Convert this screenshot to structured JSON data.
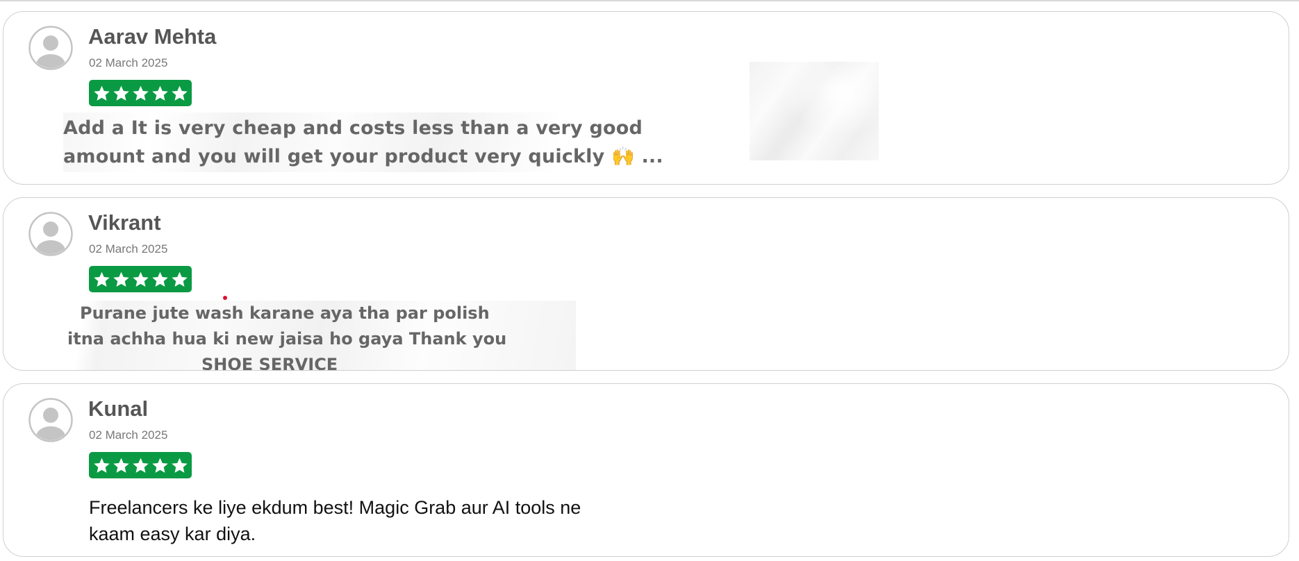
{
  "reviews": [
    {
      "name": "Aarav Mehta",
      "date": "02 March 2025",
      "rating": 5,
      "text_lines": [
        "Add a It is very cheap and costs less than a very good",
        "amount and you will get your product very quickly 🙌 ..."
      ],
      "text_style": "image"
    },
    {
      "name": "Vikrant",
      "date": "02 March 2025",
      "rating": 5,
      "text_lines": [
        "Purane jute wash karane aya tha par polish",
        "itna achha hua ki new jaisa ho gaya Thank you",
        "SHOE SERVICE"
      ],
      "text_style": "image"
    },
    {
      "name": "Kunal",
      "date": "02 March 2025",
      "rating": 5,
      "text": "Freelancers ke liye ekdum best! Magic Grab aur AI tools ne kaam easy kar diya.",
      "text_style": "plain"
    }
  ],
  "colors": {
    "rating_badge": "#0a9a43",
    "name_text": "#555555",
    "date_text": "#777777",
    "card_border": "#cfcfcf",
    "avatar": "#c4c4c4"
  },
  "icons": {
    "avatar": "user-avatar-icon",
    "star": "star-icon"
  }
}
